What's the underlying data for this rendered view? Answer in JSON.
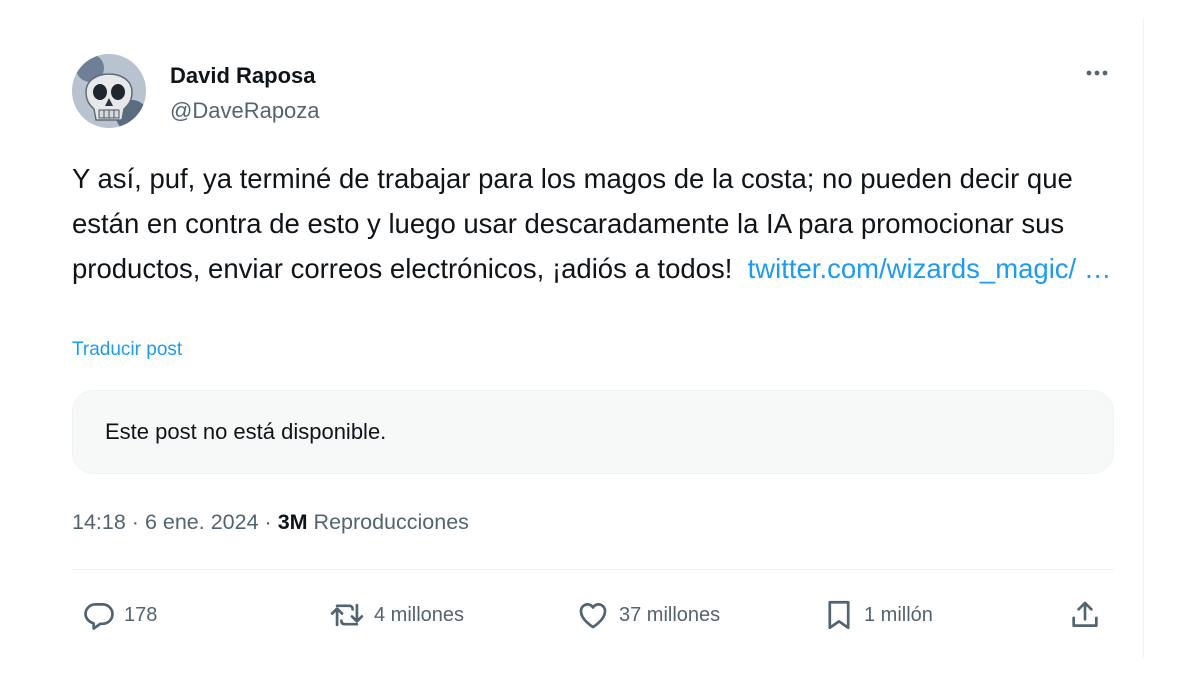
{
  "author": {
    "name": "David Raposa",
    "handle": "@DaveRapoza"
  },
  "post": {
    "text": "Y así, puf, ya terminé de trabajar para los magos de la costa; no pueden decir que están en contra de esto y luego usar descaradamente la IA para promocionar sus productos, enviar correos electrónicos, ¡adiós a todos!",
    "link_text": "twitter.com/wizards_magic/ …",
    "translate_label": "Traducir post",
    "quoted_unavailable": "Este post no está disponible."
  },
  "meta": {
    "time": "14:18",
    "separator": "·",
    "date": "6 ene. 2024",
    "views_count": "3M",
    "views_label": "Reproducciones"
  },
  "actions": {
    "replies": "178",
    "reposts": "4 millones",
    "likes": "37 millones",
    "bookmarks": "1 millón"
  },
  "colors": {
    "accent": "#1d9bf0",
    "text_primary": "#0f1419",
    "text_secondary": "#536471",
    "border": "#eff3f4"
  },
  "icons": [
    "more-icon",
    "reply-icon",
    "repost-icon",
    "like-icon",
    "bookmark-icon",
    "share-icon"
  ]
}
